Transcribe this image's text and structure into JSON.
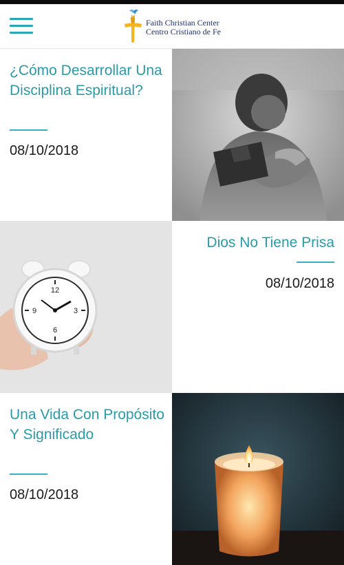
{
  "header": {
    "menu_icon": "hamburger-menu-icon",
    "logo_line1": "Faith Christian Center",
    "logo_line2": "Centro Cristiano de Fe",
    "accent_color": "#2aa7b6"
  },
  "posts": [
    {
      "title": "¿Cómo Desarrollar Una Disciplina Espiritual?",
      "date": "08/10/2018",
      "image": "man-praying-holding-bible-image"
    },
    {
      "title": "Dios No Tiene Prisa",
      "date": "08/10/2018",
      "image": "hand-holding-alarm-clock-image"
    },
    {
      "title": "Una Vida Con Propósito Y Significado",
      "date": "08/10/2018",
      "image": "lit-candle-image"
    }
  ]
}
